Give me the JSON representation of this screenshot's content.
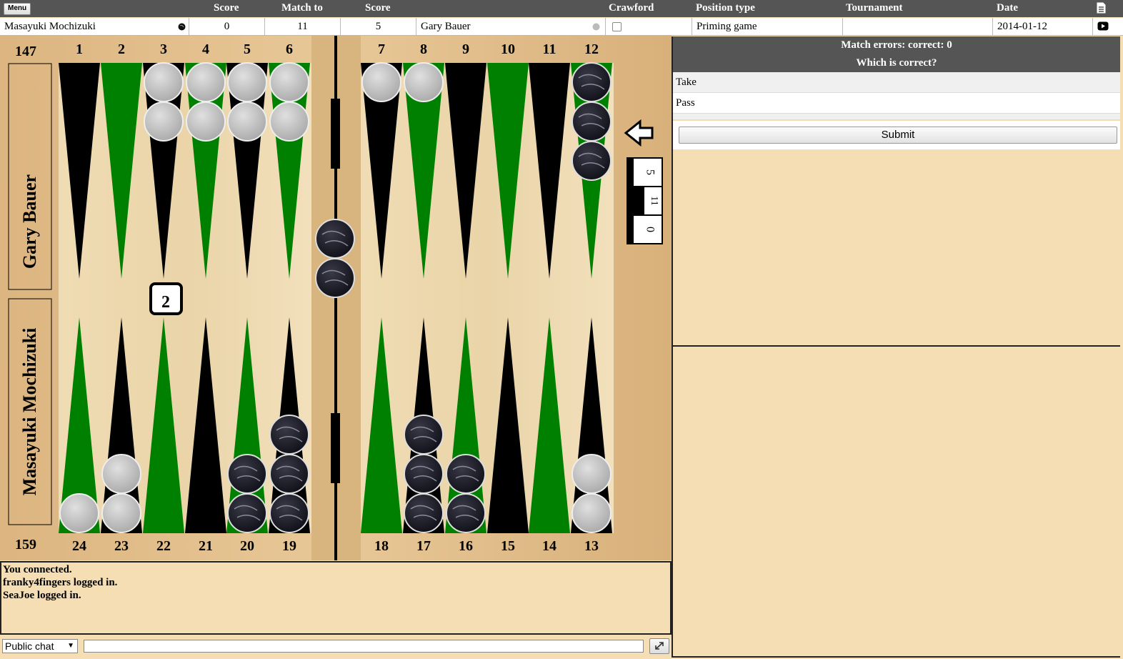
{
  "topbar": {
    "menu_label": "Menu",
    "headers": {
      "score_left": "Score",
      "match_to": "Match to",
      "score_right": "Score",
      "crawford": "Crawford",
      "position_type": "Position type",
      "tournament": "Tournament",
      "date": "Date"
    }
  },
  "match": {
    "player_bottom": "Masayuki Mochizuki",
    "score_bottom": "0",
    "match_to": "11",
    "score_top": "5",
    "player_top": "Gary Bauer",
    "crawford_checked": false,
    "position_type": "Priming game",
    "tournament": "",
    "date": "2014-01-12"
  },
  "board": {
    "pip_top": "147",
    "pip_bottom": "159",
    "side_name_top": "Gary Bauer",
    "side_name_bottom": "Masayuki Mochizuki",
    "cube_value": "2",
    "score_stack": [
      "5",
      "11",
      "0"
    ],
    "point_labels_top": [
      "1",
      "2",
      "3",
      "4",
      "5",
      "6",
      "7",
      "8",
      "9",
      "10",
      "11",
      "12"
    ],
    "point_labels_bottom": [
      "24",
      "23",
      "22",
      "21",
      "20",
      "19",
      "18",
      "17",
      "16",
      "15",
      "14",
      "13"
    ],
    "colors": {
      "wood": "#e8d2a8",
      "dark_point": "#000000",
      "green_point": "#008000",
      "white_checker": "#c8c8c8",
      "black_checker": "#1c1c28"
    }
  },
  "quiz": {
    "errors_line": "Match errors: correct: 0",
    "question": "Which is correct?",
    "options": [
      "Take",
      "Pass"
    ],
    "submit_label": "Submit"
  },
  "chat": {
    "messages": [
      "You connected.",
      "franky4fingers logged in.",
      "SeaJoe logged in."
    ],
    "channel": "Public chat",
    "input_value": ""
  }
}
